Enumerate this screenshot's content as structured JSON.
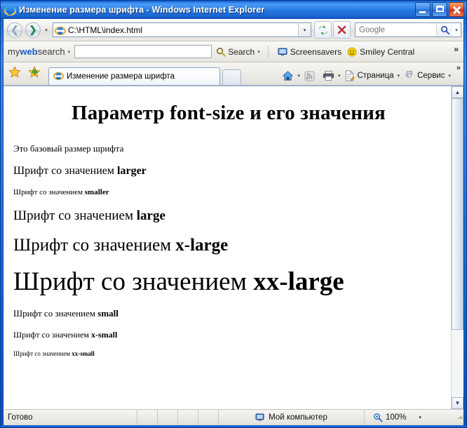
{
  "window": {
    "title": "Изменение размера шрифта - Windows Internet Explorer",
    "icon": "ie-logo-icon",
    "buttons": {
      "minimize": "Свернуть",
      "maximize": "Развернуть",
      "close": "Закрыть"
    }
  },
  "navbar": {
    "back_label": "Назад",
    "forward_label": "Вперед",
    "recent_caret": "▾",
    "address": {
      "value": "C:\\HTML\\index.html",
      "icon": "ie-logo-icon",
      "dropdown_caret": "▾"
    },
    "refresh_label": "Обновить",
    "stop_label": "Остановить",
    "search": {
      "placeholder": "Google",
      "button_label": "Поиск",
      "dropdown_caret": "▾"
    }
  },
  "mywebsearch": {
    "logo_pre": "my",
    "logo_mid": "web",
    "logo_post": "search",
    "logo_caret": "▾",
    "input_value": "",
    "search_label": "Search",
    "search_caret": "▾",
    "items": [
      {
        "label": "Screensavers",
        "icon": "monitor-icon"
      },
      {
        "label": "Smiley Central",
        "icon": "smiley-icon"
      }
    ],
    "overflow_chevron": "»"
  },
  "tabbar": {
    "favorites_center_label": "Центр избранного",
    "add_favorite_label": "Добавить в избранное",
    "tabs": [
      {
        "label": "Изменение размера шрифта",
        "icon": "ie-logo-icon",
        "active": true
      }
    ],
    "new_tab_label": "Новая вкладка",
    "commands": [
      {
        "label": "",
        "icon": "home-icon",
        "caret": "▾"
      },
      {
        "label": "",
        "icon": "rss-feed-icon",
        "caret": ""
      },
      {
        "label": "",
        "icon": "printer-icon",
        "caret": "▾"
      },
      {
        "label": "Страница",
        "icon": "page-icon",
        "caret": "▾"
      },
      {
        "label": "Сервис",
        "icon": "gear-icon",
        "caret": "▾"
      }
    ],
    "overflow_chevron": "»"
  },
  "page": {
    "heading": "Параметр font-size и его значения",
    "paragraphs": [
      {
        "text": "Это базовый размер шрифта",
        "value": "",
        "size_class": "p-base"
      },
      {
        "text": "Шрифт со значением ",
        "value": "larger",
        "size_class": "p-larger"
      },
      {
        "text": "Шрифт со значением ",
        "value": "smaller",
        "size_class": "p-smaller"
      },
      {
        "text": "Шрифт со значением ",
        "value": "large",
        "size_class": "p-large"
      },
      {
        "text": "Шрифт со значением ",
        "value": "x-large",
        "size_class": "p-xlarge"
      },
      {
        "text": "Шрифт со значением ",
        "value": "xx-large",
        "size_class": "p-xxlarge"
      },
      {
        "text": "Шрифт со значением ",
        "value": "small",
        "size_class": "p-small"
      },
      {
        "text": "Шрифт со значением ",
        "value": "x-small",
        "size_class": "p-xsmall"
      },
      {
        "text": "Шрифт со значением ",
        "value": "xx-small",
        "size_class": "p-xxsmall"
      }
    ]
  },
  "scrollbar": {
    "up_arrow": "▲",
    "down_arrow": "▼"
  },
  "statusbar": {
    "status": "Готово",
    "zone": "Мой компьютер",
    "zone_icon": "monitor-icon",
    "zoom": "100%",
    "zoom_icon": "magnifier-icon",
    "zoom_caret": "▾"
  },
  "colors": {
    "titlebar_blue": "#1f75e0",
    "close_red": "#d0361c",
    "accent_link": "#1b57c4",
    "page_bg": "#ffffff"
  }
}
